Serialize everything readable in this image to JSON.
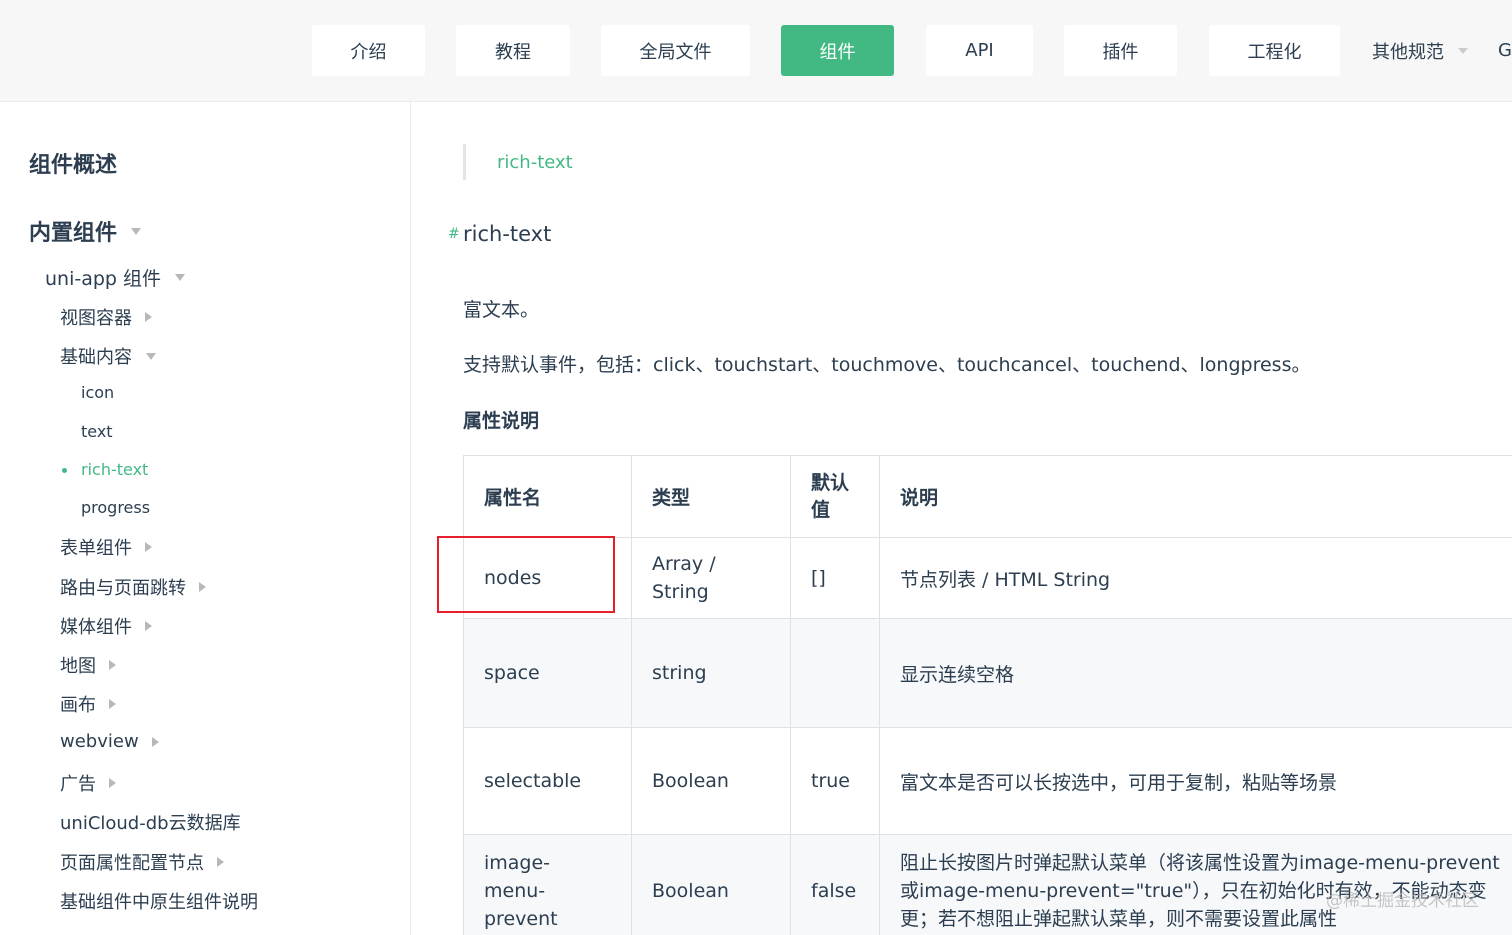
{
  "nav": {
    "items": [
      "介绍",
      "教程",
      "全局文件",
      "组件",
      "API",
      "插件",
      "工程化"
    ],
    "more_label": "其他规范",
    "overflow_letter": "G"
  },
  "sidebar": {
    "heading_overview": "组件概述",
    "heading_builtin": "内置组件",
    "uniapp_components": "uni-app 组件",
    "view_container": "视图容器",
    "basic_content": "基础内容",
    "icon": "icon",
    "text": "text",
    "rich_text": "rich-text",
    "progress": "progress",
    "form": "表单组件",
    "routing": "路由与页面跳转",
    "media": "媒体组件",
    "map": "地图",
    "canvas": "画布",
    "webview": "webview",
    "ads": "广告",
    "unicloud": "uniCloud-db云数据库",
    "page_meta": "页面属性配置节点",
    "native_note": "基础组件中原生组件说明"
  },
  "content": {
    "breadcrumb": "rich-text",
    "anchor": "#",
    "title": "rich-text",
    "desc1": "富文本。",
    "desc2": "支持默认事件，包括：click、touchstart、touchmove、touchcancel、touchend、longpress。",
    "attr_heading": "属性说明",
    "table": {
      "headers": [
        "属性名",
        "类型",
        "默认值",
        "说明"
      ],
      "rows": [
        [
          "nodes",
          "Array / String",
          "[]",
          "节点列表 / HTML String"
        ],
        [
          "space",
          "string",
          "",
          "显示连续空格"
        ],
        [
          "selectable",
          "Boolean",
          "true",
          "富文本是否可以长按选中，可用于复制，粘贴等场景"
        ],
        [
          "image-menu-prevent",
          "Boolean",
          "false",
          "阻止长按图片时弹起默认菜单（将该属性设置为image-menu-prevent或image-menu-prevent=\"true\"），只在初始化时有效，不能动态变更；若不想阻止弹起默认菜单，则不需要设置此属性"
        ]
      ]
    }
  },
  "watermark": "@稀土掘金技术社区",
  "colors": {
    "accent": "#42b983",
    "highlight": "#e5202a"
  }
}
